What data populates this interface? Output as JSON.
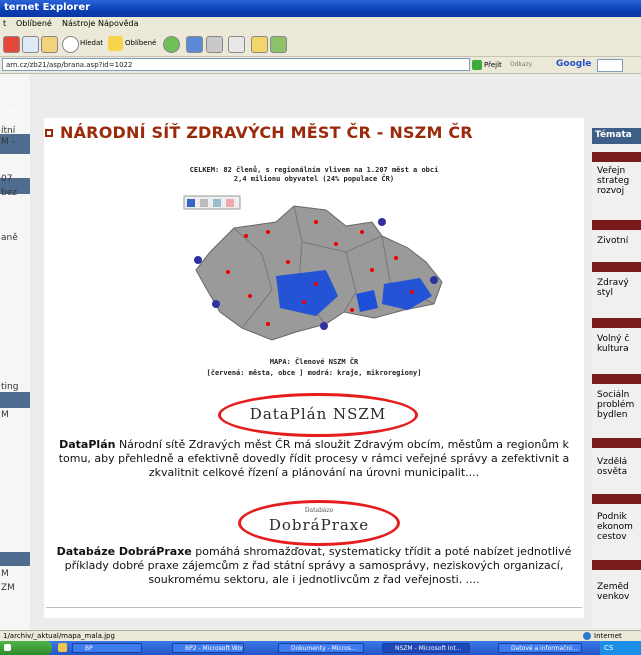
{
  "window": {
    "title": "ternet Explorer"
  },
  "menu": [
    "t",
    "Oblíbené",
    "Nástroje",
    "Nápověda"
  ],
  "toolbar": {
    "search_label": "Hledat",
    "favorites_label": "Oblíbené"
  },
  "address": {
    "url": "arn.cz/zb21/asp/brana.asp?id=1022",
    "go_label": "Přejít",
    "links_label": "Odkazy",
    "google_label": "Google"
  },
  "left": {
    "snippets": [
      "e",
      "ítní",
      "M -",
      "07",
      "bez",
      "aně",
      "ting",
      "M",
      "M",
      "ZM"
    ]
  },
  "page": {
    "title": "NÁRODNÍ SÍŤ ZDRAVÝCH MĚST ČR - NSZM ČR",
    "stats_line1": "CELKEM: 82 členů, s regionálním vlivem na 1.207 měst a obcí",
    "stats_line2": "2,4 milionu obyvatel (24% populace ČR)",
    "map_caption1": "MAPA: Členové NSZM ČR",
    "map_caption2": "[červená: města, obce ] modrá: kraje, mikroregiony]",
    "dataplan_logo": "DataPlán NSZM",
    "dataplan_bold": "DataPlán",
    "dataplan_text": " Národní sítě Zdravých měst ČR má sloužit Zdravým obcím, městům a regionům k tomu, aby přehledně a efektivně dovedly řídit procesy v rámci veřejné správy a zefektivnit a zkvalitnit celkové řízení a plánování na úrovni municipalit....",
    "databaze_small": "Databáze",
    "dobrapraxe_logo": "DobráPraxe",
    "dobrapraxe_bold": "Databáze DobráPraxe",
    "dobrapraxe_text": " pomáhá shromažďovat, systematicky třídit a poté nabízet jednotlivé příklady dobré praxe zájemcům z řad státní správy a samosprávy, neziskových organizací, soukromému sektoru, ale i jednotlivcům z řad veřejnosti. ...."
  },
  "right": {
    "header": "Témata",
    "items": [
      "Veřejn strateg rozvoj",
      "Životní",
      "Zdravý styl",
      "Volný č kultura",
      "Sociáln problém bydlen",
      "Vzdělá osvěta",
      "Podnik ekonom cestov",
      "Zeměd venkov"
    ]
  },
  "status": {
    "left": "1/archiv/_aktual/mapa_mala.jpg",
    "right": "Internet"
  },
  "taskbar": {
    "start": "",
    "items": [
      "BP",
      "BP2 - Microsoft Word",
      "Dokumenty - Micros...",
      "NSZM - Microsoft Int...",
      "Datové a informační..."
    ],
    "tray": "CS"
  },
  "colors": {
    "title": "#9b2a0a",
    "ellipse": "#e51d1d",
    "map_member": "#1e4fd8",
    "map_land": "#9a9a9a"
  }
}
